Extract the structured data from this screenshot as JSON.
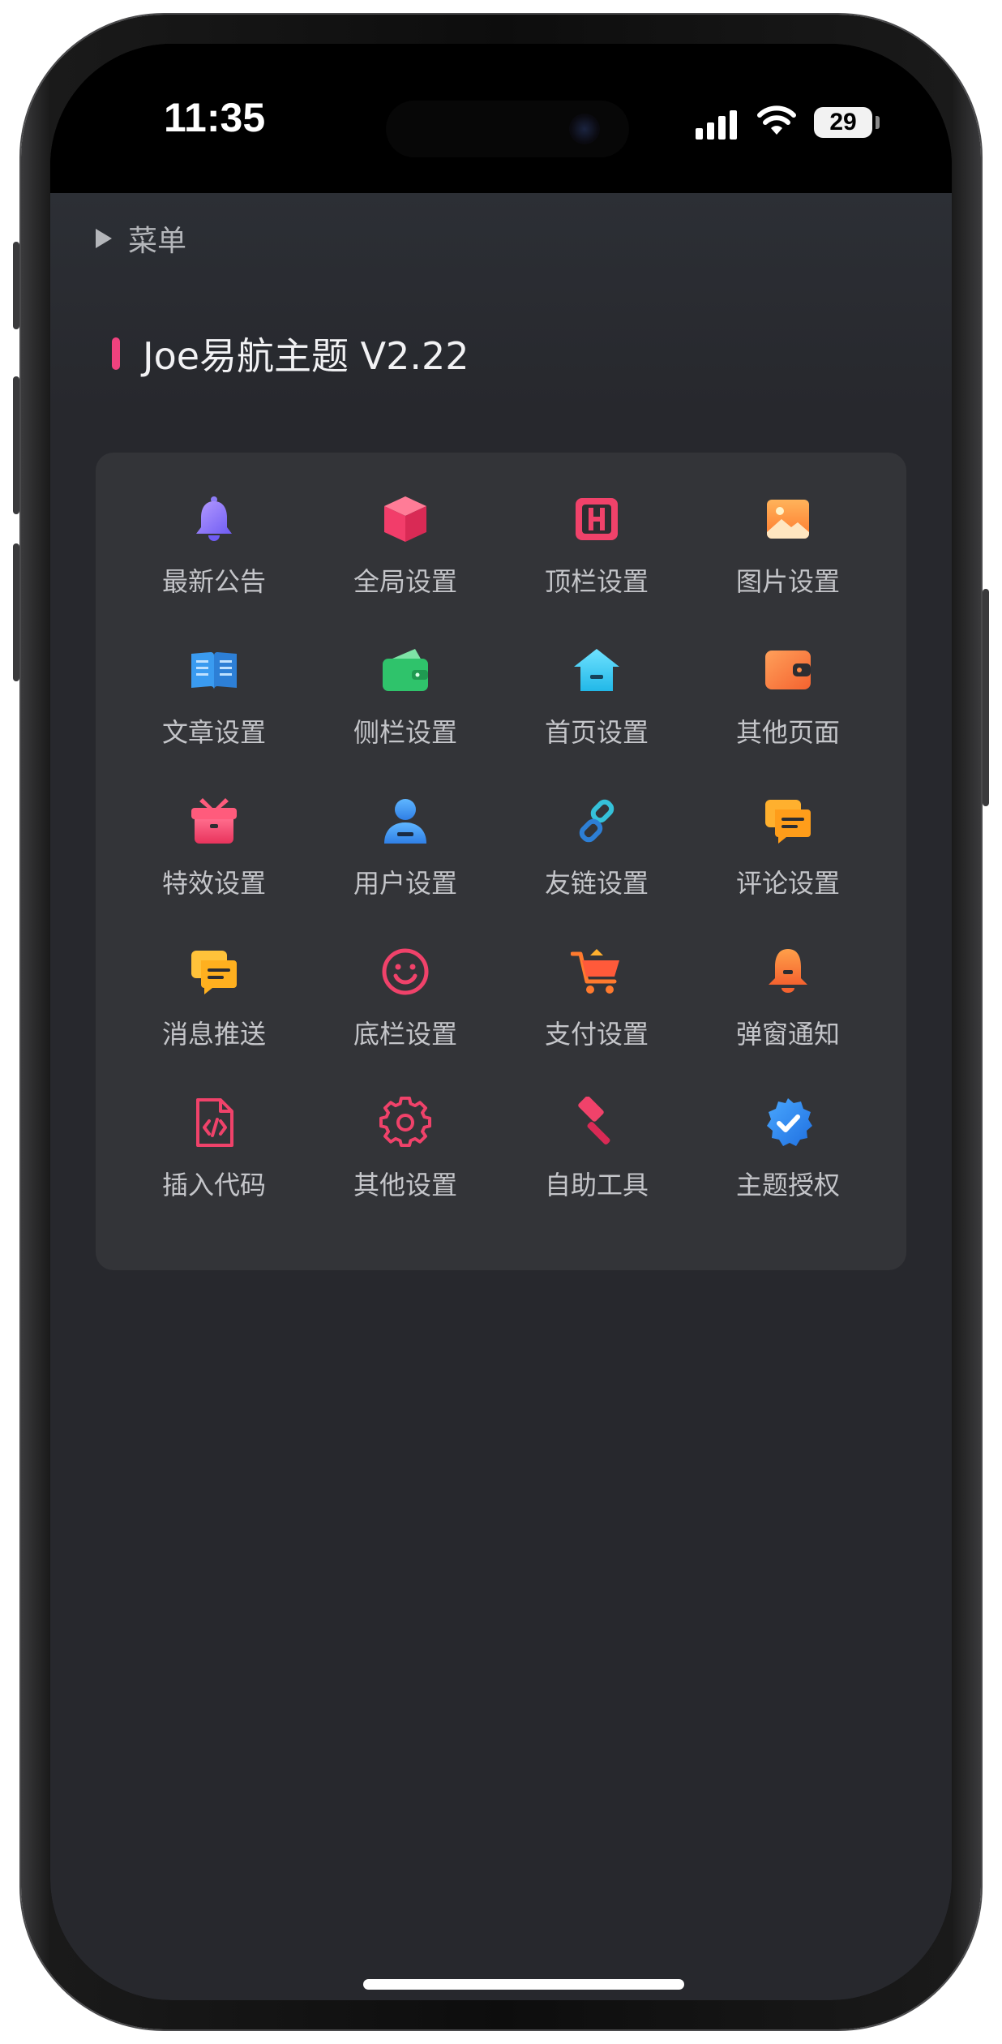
{
  "status_bar": {
    "time": "11:35",
    "battery": "29"
  },
  "menu": {
    "label": "菜单"
  },
  "app": {
    "title": "Joe易航主题 V2.22",
    "accent_color": "#f0427e"
  },
  "grid": {
    "items": [
      {
        "label": "最新公告",
        "icon": "bell-icon"
      },
      {
        "label": "全局设置",
        "icon": "cube-icon"
      },
      {
        "label": "顶栏设置",
        "icon": "h-square-icon"
      },
      {
        "label": "图片设置",
        "icon": "image-icon"
      },
      {
        "label": "文章设置",
        "icon": "book-icon"
      },
      {
        "label": "侧栏设置",
        "icon": "wallet-icon"
      },
      {
        "label": "首页设置",
        "icon": "home-icon"
      },
      {
        "label": "其他页面",
        "icon": "purse-icon"
      },
      {
        "label": "特效设置",
        "icon": "gift-icon"
      },
      {
        "label": "用户设置",
        "icon": "user-icon"
      },
      {
        "label": "友链设置",
        "icon": "link-icon"
      },
      {
        "label": "评论设置",
        "icon": "comment-icon"
      },
      {
        "label": "消息推送",
        "icon": "message-icon"
      },
      {
        "label": "底栏设置",
        "icon": "smile-icon"
      },
      {
        "label": "支付设置",
        "icon": "cart-icon"
      },
      {
        "label": "弹窗通知",
        "icon": "alert-bell-icon"
      },
      {
        "label": "插入代码",
        "icon": "code-file-icon"
      },
      {
        "label": "其他设置",
        "icon": "gear-icon"
      },
      {
        "label": "自助工具",
        "icon": "hammer-icon"
      },
      {
        "label": "主题授权",
        "icon": "verified-badge-icon"
      }
    ]
  }
}
